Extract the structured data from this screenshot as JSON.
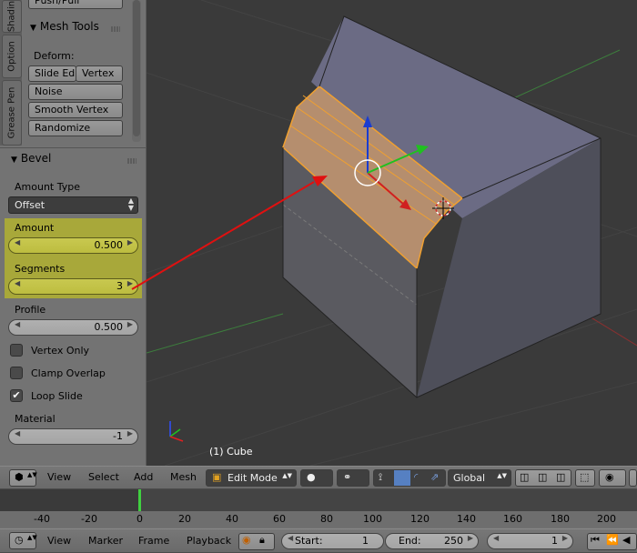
{
  "tool_tabs": [
    "Shadin",
    "Option",
    "Grease Pen"
  ],
  "mesh_tools": {
    "partial_button": "Push/Pull",
    "title": "Mesh Tools",
    "deform_label": "Deform:",
    "slide_edge": "Slide Ed",
    "vertex": "Vertex",
    "noise": "Noise",
    "smooth_vertex": "Smooth Vertex",
    "randomize": "Randomize"
  },
  "bevel": {
    "title": "Bevel",
    "amount_type_label": "Amount Type",
    "amount_type_value": "Offset",
    "amount_label": "Amount",
    "amount_value": "0.500",
    "segments_label": "Segments",
    "segments_value": "3",
    "profile_label": "Profile",
    "profile_value": "0.500",
    "vertex_only_label": "Vertex Only",
    "vertex_only_checked": false,
    "clamp_overlap_label": "Clamp Overlap",
    "clamp_overlap_checked": false,
    "loop_slide_label": "Loop Slide",
    "loop_slide_checked": true,
    "material_label": "Material",
    "material_value": "-1"
  },
  "viewport": {
    "object_label": "(1) Cube",
    "highlight_color": "#a8a83a",
    "selection_color": "#f0a030",
    "arrow_color": "#e01010"
  },
  "header": {
    "view": "View",
    "select": "Select",
    "add": "Add",
    "mesh": "Mesh",
    "mode": "Edit Mode",
    "orientation": "Global"
  },
  "timeline": {
    "ticks": [
      "-40",
      "-20",
      "0",
      "20",
      "40",
      "60",
      "80",
      "100",
      "120",
      "140",
      "160",
      "180",
      "200"
    ],
    "current_frame_marker": "0"
  },
  "footer": {
    "view": "View",
    "marker": "Marker",
    "frame": "Frame",
    "playback": "Playback",
    "start_label": "Start:",
    "start_value": "1",
    "end_label": "End:",
    "end_value": "250",
    "current_frame": "1"
  }
}
